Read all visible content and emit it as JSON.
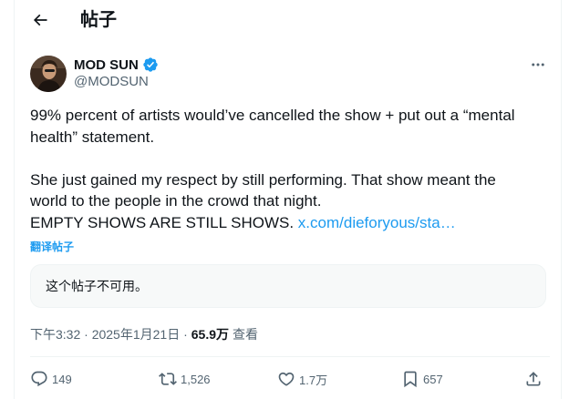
{
  "header": {
    "title": "帖子",
    "back_icon": "arrow-left-icon"
  },
  "author": {
    "display_name": "MOD SUN",
    "handle": "@MODSUN",
    "verified": true,
    "verified_color": "#1d9bf0"
  },
  "tweet": {
    "paragraph1": [
      "99% percent of artists would’ve cancelled the show + put out a “mental",
      "health” statement."
    ],
    "paragraph2": [
      "She just gained my respect by still performing. That show meant the",
      "world to the people in the crowd that night."
    ],
    "last_line_text": "EMPTY SHOWS ARE STILL SHOWS.",
    "link_text": "x.com/dieforyous/sta…",
    "translate_label": "翻译帖子"
  },
  "quoted": {
    "unavailable_text": "这个帖子不可用。"
  },
  "meta": {
    "timestamp": "下午3:32 · 2025年1月21日 · ",
    "views": "65.9万",
    "views_label": "查看"
  },
  "actions": {
    "replies": "149",
    "reposts": "1,526",
    "likes": "1.7万",
    "bookmarks": "657"
  },
  "colors": {
    "accent": "#1d9bf0",
    "text": "#0f1419",
    "secondary": "#536471",
    "border": "#eff3f4"
  }
}
